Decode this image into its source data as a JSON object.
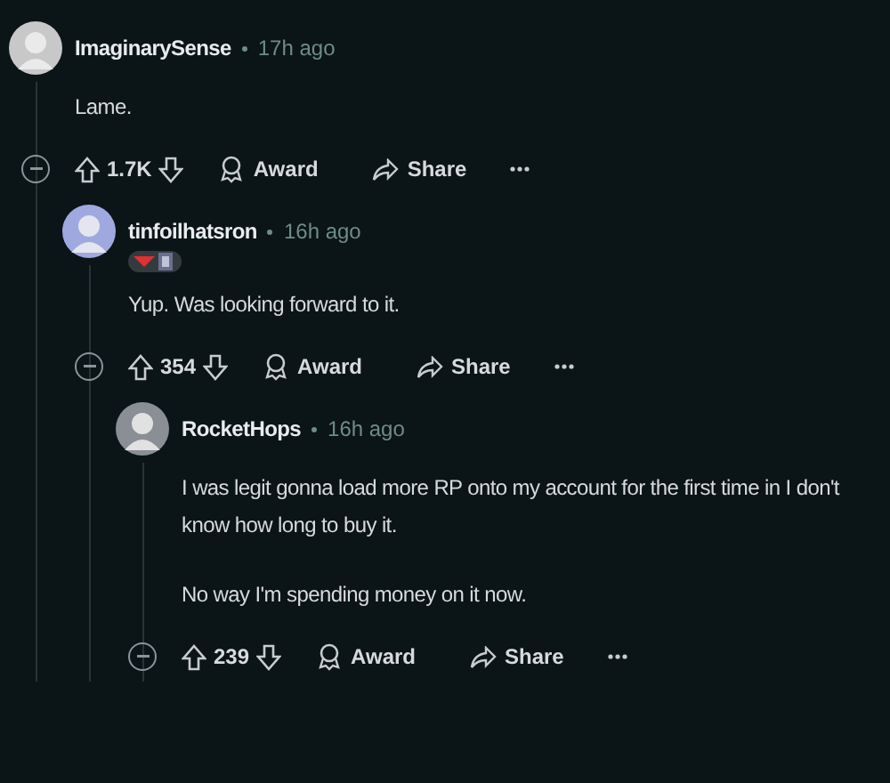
{
  "comments": [
    {
      "author": "ImaginarySense",
      "time": "17h ago",
      "paragraphs": [
        "Lame."
      ],
      "votes": "1.7K",
      "award": "Award",
      "share": "Share",
      "children": [
        {
          "author": "tinfoilhatsron",
          "time": "16h ago",
          "flair": true,
          "paragraphs": [
            "Yup. Was looking forward to it."
          ],
          "votes": "354",
          "award": "Award",
          "share": "Share",
          "children": [
            {
              "author": "RocketHops",
              "time": "16h ago",
              "paragraphs": [
                "I was legit gonna load more RP onto my account for the first time in I don't know how long to buy it.",
                "No way I'm spending money on it now."
              ],
              "votes": "239",
              "award": "Award",
              "share": "Share"
            }
          ]
        }
      ]
    }
  ]
}
